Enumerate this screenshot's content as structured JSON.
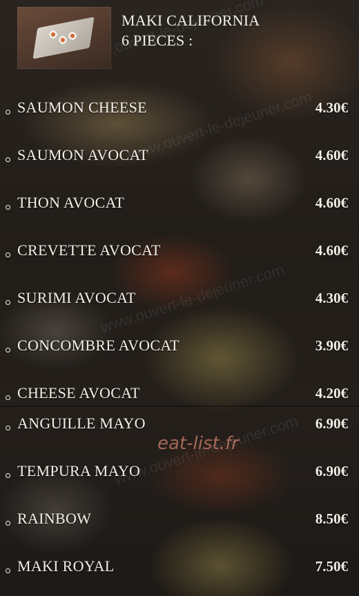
{
  "header": {
    "line1": "MAKI CALIFORNIA",
    "line2": "6 PIECES :"
  },
  "watermark_text": "www.ouvert-le-dejeuner.com",
  "brand_text": "eat-list.fr",
  "items": [
    {
      "name": "SAUMON CHEESE",
      "price": "4.30€"
    },
    {
      "name": "SAUMON AVOCAT",
      "price": "4.60€"
    },
    {
      "name": "THON AVOCAT",
      "price": "4.60€"
    },
    {
      "name": "CREVETTE AVOCAT",
      "price": "4.60€"
    },
    {
      "name": "SURIMI AVOCAT",
      "price": "4.30€"
    },
    {
      "name": "CONCOMBRE AVOCAT",
      "price": "3.90€"
    },
    {
      "name": "CHEESE AVOCAT",
      "price": "4.20€"
    },
    {
      "name": "ANGUILLE MAYO",
      "price": "6.90€"
    },
    {
      "name": "TEMPURA MAYO",
      "price": "6.90€"
    },
    {
      "name": "RAINBOW",
      "price": "8.50€"
    },
    {
      "name": "MAKI ROYAL",
      "price": "7.50€"
    }
  ]
}
